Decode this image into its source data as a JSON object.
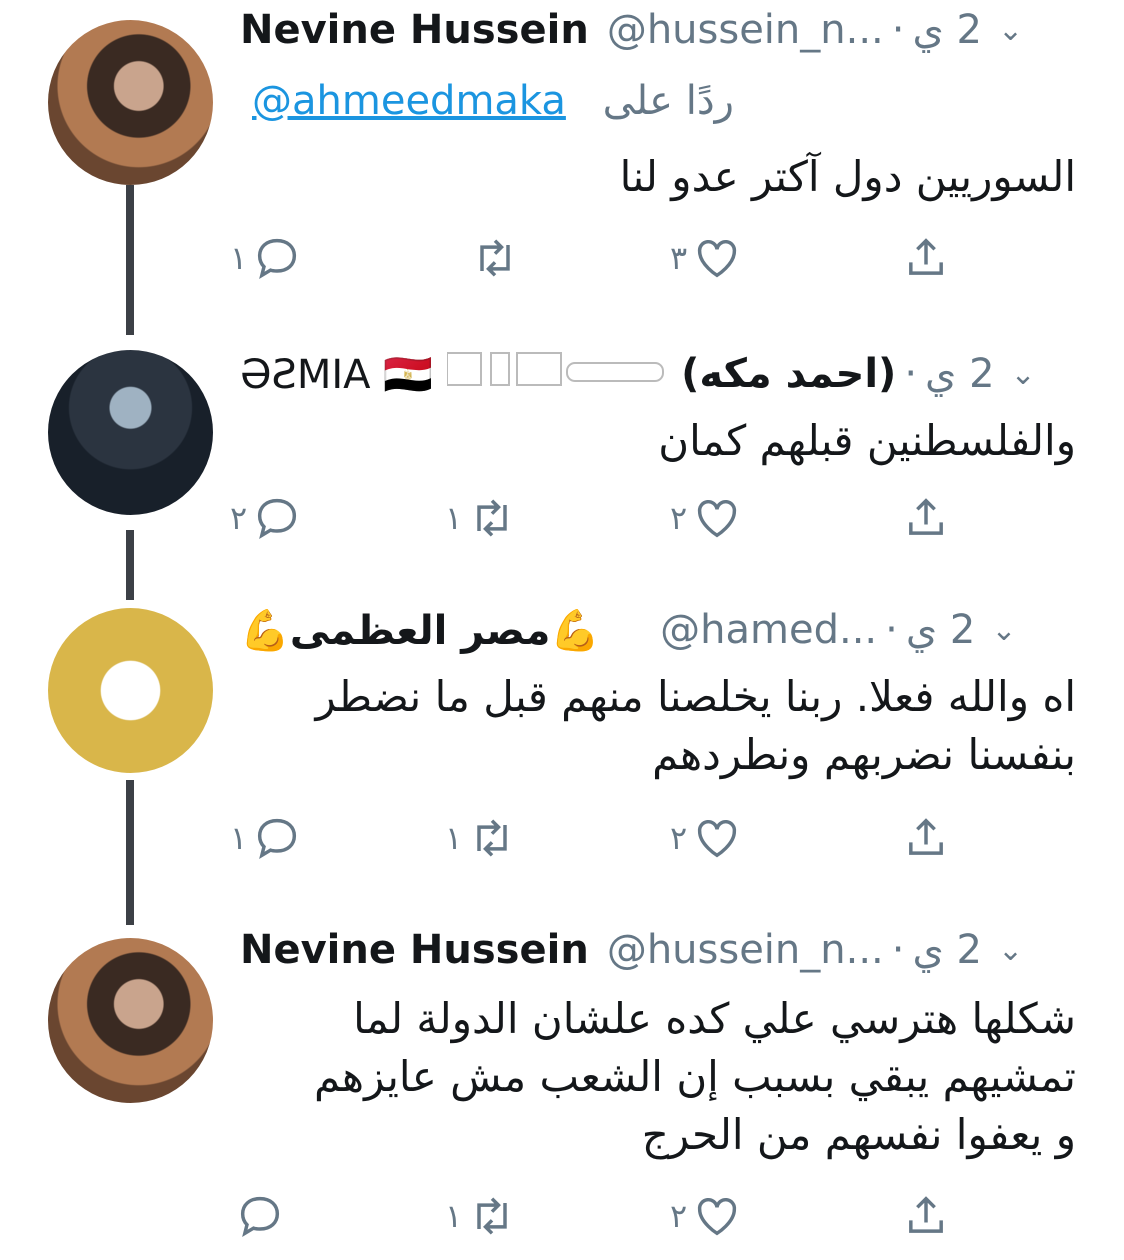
{
  "tweets": [
    {
      "name": "Nevine Hussein",
      "handle": "@hussein_n...",
      "time": "2 ي",
      "dot": "·",
      "replying_label": "ردًا على",
      "replying_to": "@ahmeedmaka",
      "text": [
        "السوريين دول آكتر عدو لنا"
      ],
      "counts": {
        "reply": "١",
        "retweet": "",
        "like": "٣"
      }
    },
    {
      "name": "(احمد مكه)",
      "name_suffix": "ƏƧMIA 🇪🇬",
      "time": "2 ي",
      "dot": "·",
      "text": [
        "والفلسطنين قبلهم كمان"
      ],
      "counts": {
        "reply": "٢",
        "retweet": "١",
        "like": "٢"
      }
    },
    {
      "name": "💪مصر العظمى💪",
      "handle": "@hamed...",
      "time": "2 ي",
      "dot": "·",
      "text": [
        "اه والله فعلا.  ربنا يخلصنا منهم قبل ما نضطر",
        "بنفسنا نضربهم ونطردهم"
      ],
      "counts": {
        "reply": "١",
        "retweet": "١",
        "like": "٢"
      }
    },
    {
      "name": "Nevine Hussein",
      "handle": "@hussein_n...",
      "time": "2 ي",
      "dot": "·",
      "text": [
        "شكلها هترسي علي كده علشان الدولة لما",
        "تمشيهم يبقي بسبب إن الشعب مش عايزهم",
        "و يعفوا نفسهم من الحرج"
      ],
      "counts": {
        "reply": "",
        "retweet": "١",
        "like": "٢"
      }
    }
  ],
  "icons": {
    "reply": "reply-icon",
    "retweet": "retweet-icon",
    "like": "heart-icon",
    "share": "share-icon",
    "chevron": "chevron-down-icon"
  },
  "colors": {
    "text": "#14171a",
    "muted": "#657786",
    "link": "#1b95e0",
    "thread_line": "#3c4046"
  }
}
